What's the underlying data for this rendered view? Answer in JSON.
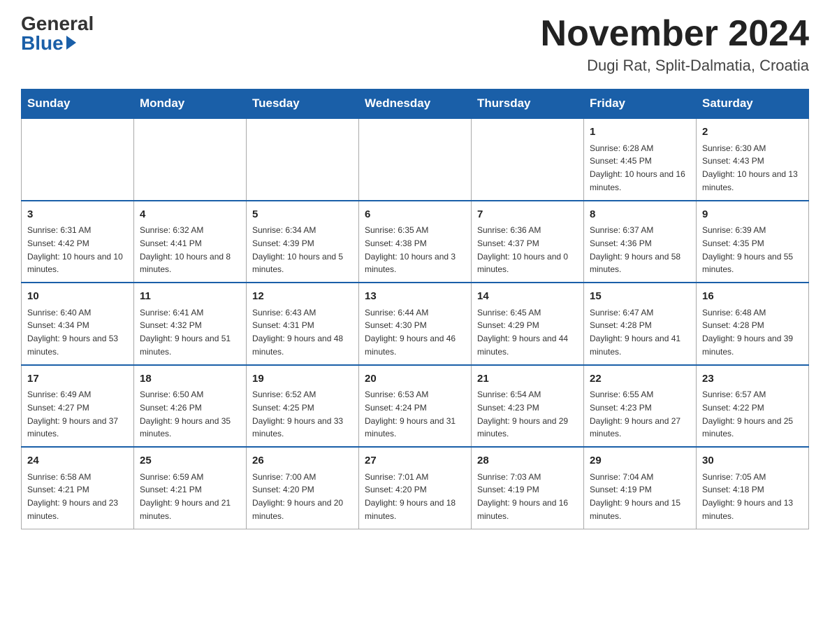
{
  "header": {
    "logo_general": "General",
    "logo_blue": "Blue",
    "month_title": "November 2024",
    "location": "Dugi Rat, Split-Dalmatia, Croatia"
  },
  "days_of_week": [
    "Sunday",
    "Monday",
    "Tuesday",
    "Wednesday",
    "Thursday",
    "Friday",
    "Saturday"
  ],
  "weeks": [
    [
      {
        "day": "",
        "info": ""
      },
      {
        "day": "",
        "info": ""
      },
      {
        "day": "",
        "info": ""
      },
      {
        "day": "",
        "info": ""
      },
      {
        "day": "",
        "info": ""
      },
      {
        "day": "1",
        "info": "Sunrise: 6:28 AM\nSunset: 4:45 PM\nDaylight: 10 hours and 16 minutes."
      },
      {
        "day": "2",
        "info": "Sunrise: 6:30 AM\nSunset: 4:43 PM\nDaylight: 10 hours and 13 minutes."
      }
    ],
    [
      {
        "day": "3",
        "info": "Sunrise: 6:31 AM\nSunset: 4:42 PM\nDaylight: 10 hours and 10 minutes."
      },
      {
        "day": "4",
        "info": "Sunrise: 6:32 AM\nSunset: 4:41 PM\nDaylight: 10 hours and 8 minutes."
      },
      {
        "day": "5",
        "info": "Sunrise: 6:34 AM\nSunset: 4:39 PM\nDaylight: 10 hours and 5 minutes."
      },
      {
        "day": "6",
        "info": "Sunrise: 6:35 AM\nSunset: 4:38 PM\nDaylight: 10 hours and 3 minutes."
      },
      {
        "day": "7",
        "info": "Sunrise: 6:36 AM\nSunset: 4:37 PM\nDaylight: 10 hours and 0 minutes."
      },
      {
        "day": "8",
        "info": "Sunrise: 6:37 AM\nSunset: 4:36 PM\nDaylight: 9 hours and 58 minutes."
      },
      {
        "day": "9",
        "info": "Sunrise: 6:39 AM\nSunset: 4:35 PM\nDaylight: 9 hours and 55 minutes."
      }
    ],
    [
      {
        "day": "10",
        "info": "Sunrise: 6:40 AM\nSunset: 4:34 PM\nDaylight: 9 hours and 53 minutes."
      },
      {
        "day": "11",
        "info": "Sunrise: 6:41 AM\nSunset: 4:32 PM\nDaylight: 9 hours and 51 minutes."
      },
      {
        "day": "12",
        "info": "Sunrise: 6:43 AM\nSunset: 4:31 PM\nDaylight: 9 hours and 48 minutes."
      },
      {
        "day": "13",
        "info": "Sunrise: 6:44 AM\nSunset: 4:30 PM\nDaylight: 9 hours and 46 minutes."
      },
      {
        "day": "14",
        "info": "Sunrise: 6:45 AM\nSunset: 4:29 PM\nDaylight: 9 hours and 44 minutes."
      },
      {
        "day": "15",
        "info": "Sunrise: 6:47 AM\nSunset: 4:28 PM\nDaylight: 9 hours and 41 minutes."
      },
      {
        "day": "16",
        "info": "Sunrise: 6:48 AM\nSunset: 4:28 PM\nDaylight: 9 hours and 39 minutes."
      }
    ],
    [
      {
        "day": "17",
        "info": "Sunrise: 6:49 AM\nSunset: 4:27 PM\nDaylight: 9 hours and 37 minutes."
      },
      {
        "day": "18",
        "info": "Sunrise: 6:50 AM\nSunset: 4:26 PM\nDaylight: 9 hours and 35 minutes."
      },
      {
        "day": "19",
        "info": "Sunrise: 6:52 AM\nSunset: 4:25 PM\nDaylight: 9 hours and 33 minutes."
      },
      {
        "day": "20",
        "info": "Sunrise: 6:53 AM\nSunset: 4:24 PM\nDaylight: 9 hours and 31 minutes."
      },
      {
        "day": "21",
        "info": "Sunrise: 6:54 AM\nSunset: 4:23 PM\nDaylight: 9 hours and 29 minutes."
      },
      {
        "day": "22",
        "info": "Sunrise: 6:55 AM\nSunset: 4:23 PM\nDaylight: 9 hours and 27 minutes."
      },
      {
        "day": "23",
        "info": "Sunrise: 6:57 AM\nSunset: 4:22 PM\nDaylight: 9 hours and 25 minutes."
      }
    ],
    [
      {
        "day": "24",
        "info": "Sunrise: 6:58 AM\nSunset: 4:21 PM\nDaylight: 9 hours and 23 minutes."
      },
      {
        "day": "25",
        "info": "Sunrise: 6:59 AM\nSunset: 4:21 PM\nDaylight: 9 hours and 21 minutes."
      },
      {
        "day": "26",
        "info": "Sunrise: 7:00 AM\nSunset: 4:20 PM\nDaylight: 9 hours and 20 minutes."
      },
      {
        "day": "27",
        "info": "Sunrise: 7:01 AM\nSunset: 4:20 PM\nDaylight: 9 hours and 18 minutes."
      },
      {
        "day": "28",
        "info": "Sunrise: 7:03 AM\nSunset: 4:19 PM\nDaylight: 9 hours and 16 minutes."
      },
      {
        "day": "29",
        "info": "Sunrise: 7:04 AM\nSunset: 4:19 PM\nDaylight: 9 hours and 15 minutes."
      },
      {
        "day": "30",
        "info": "Sunrise: 7:05 AM\nSunset: 4:18 PM\nDaylight: 9 hours and 13 minutes."
      }
    ]
  ]
}
